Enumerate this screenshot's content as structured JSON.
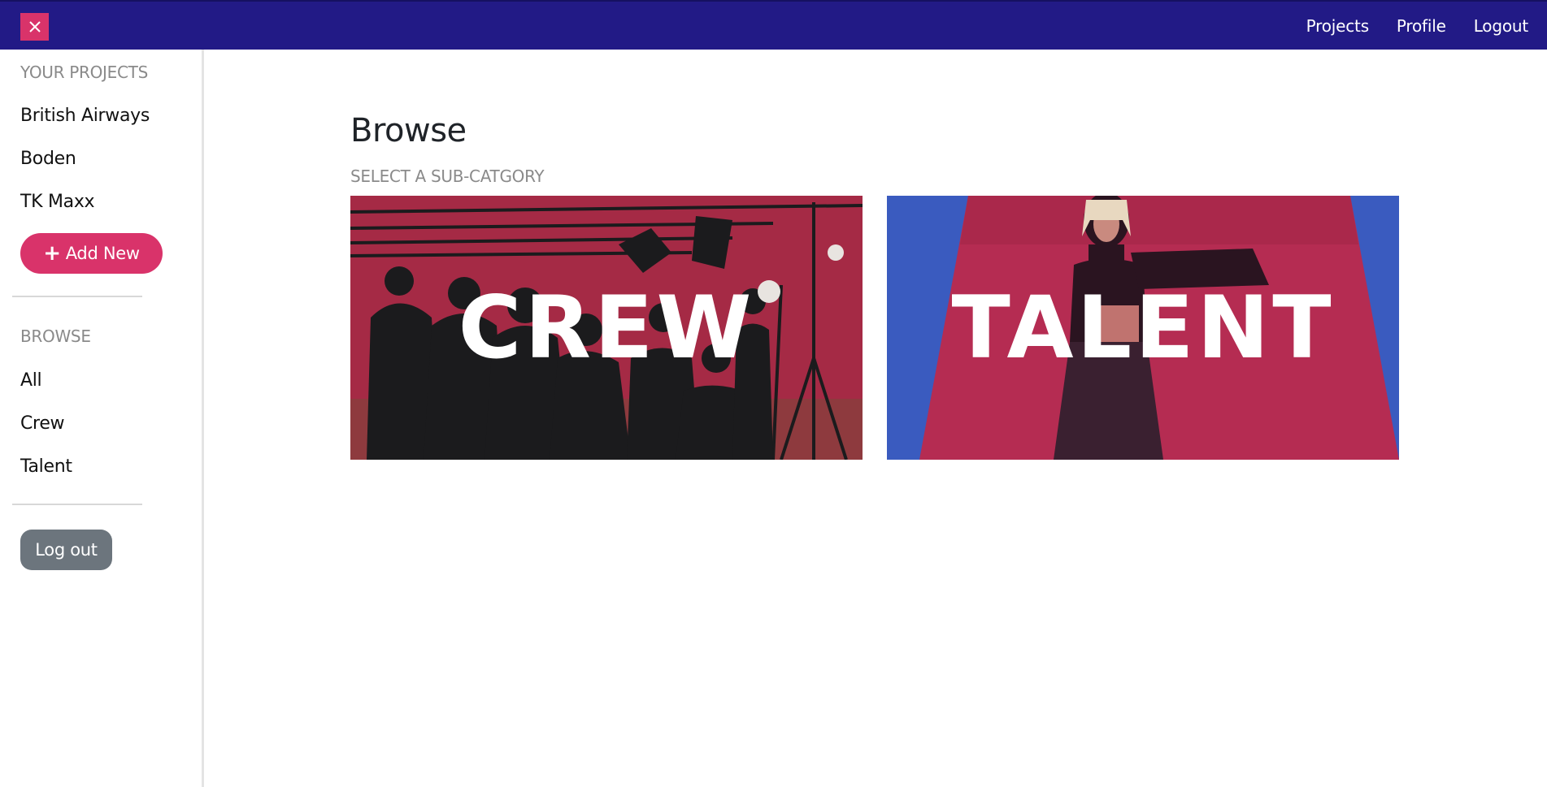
{
  "header": {
    "close_icon": "close-icon",
    "nav": [
      {
        "label": "Projects"
      },
      {
        "label": "Profile"
      },
      {
        "label": "Logout"
      }
    ]
  },
  "sidebar": {
    "projects_heading": "YOUR PROJECTS",
    "projects": [
      {
        "label": "British Airways"
      },
      {
        "label": "Boden"
      },
      {
        "label": "TK Maxx"
      }
    ],
    "add_new": {
      "icon": "plus-icon",
      "label": "Add New"
    },
    "browse_heading": "BROWSE",
    "browse": [
      {
        "label": "All"
      },
      {
        "label": "Crew"
      },
      {
        "label": "Talent"
      }
    ],
    "logout_label": "Log out"
  },
  "main": {
    "title": "Browse",
    "subtitle": "SELECT A SUB-CATGORY",
    "cards": [
      {
        "label": "CREW"
      },
      {
        "label": "TALENT"
      }
    ]
  },
  "colors": {
    "header_bg": "#221a86",
    "accent": "#d9336a",
    "secondary_button": "#6c757d"
  }
}
